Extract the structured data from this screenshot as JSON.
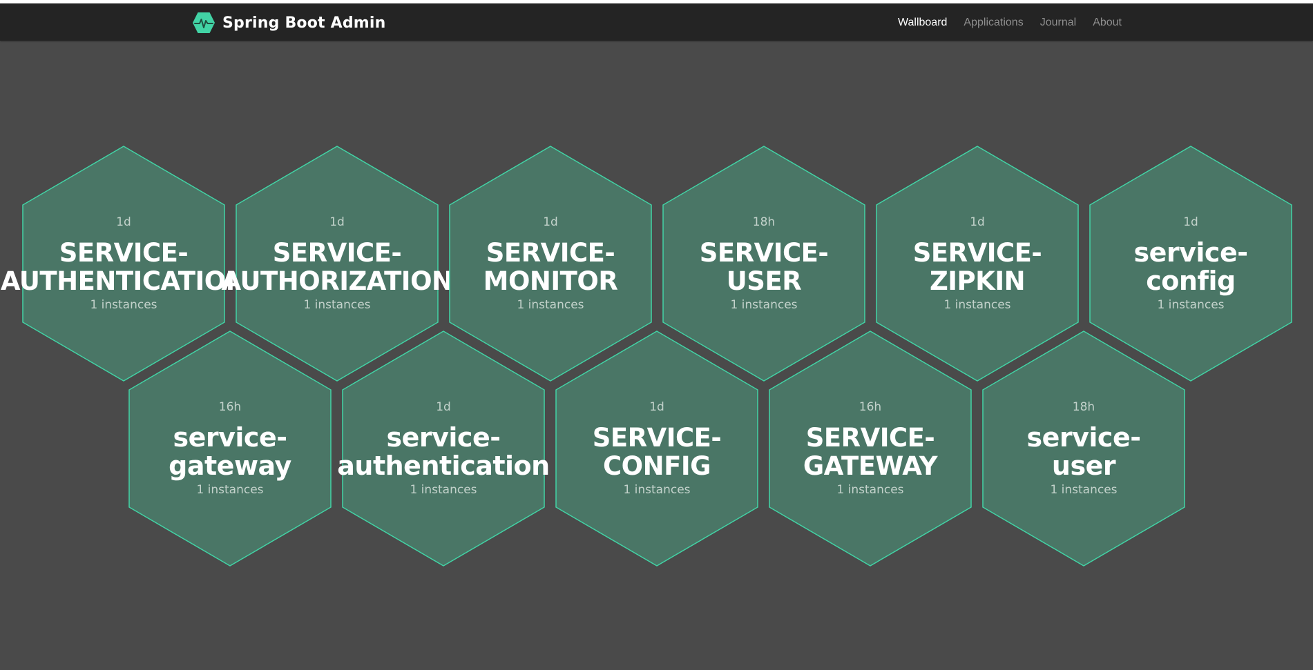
{
  "brand": {
    "title": "Spring Boot Admin",
    "icon": "heartbeat-icon",
    "accent": "#42d3a5"
  },
  "nav": [
    {
      "label": "Wallboard",
      "active": true
    },
    {
      "label": "Applications",
      "active": false
    },
    {
      "label": "Journal",
      "active": false
    },
    {
      "label": "About",
      "active": false
    }
  ],
  "colors": {
    "background": "#4a4a4a",
    "navbar": "#242424",
    "hex_fill": "#4a7666",
    "hex_stroke": "#42d3a5"
  },
  "applications": [
    {
      "uptime": "1d",
      "name_line1": "SERVICE-",
      "name_line2": "AUTHENTICATION",
      "instances": "1 instances"
    },
    {
      "uptime": "1d",
      "name_line1": "SERVICE-",
      "name_line2": "AUTHORIZATION",
      "instances": "1 instances"
    },
    {
      "uptime": "1d",
      "name_line1": "SERVICE-",
      "name_line2": "MONITOR",
      "instances": "1 instances"
    },
    {
      "uptime": "18h",
      "name_line1": "SERVICE-",
      "name_line2": "USER",
      "instances": "1 instances"
    },
    {
      "uptime": "1d",
      "name_line1": "SERVICE-",
      "name_line2": "ZIPKIN",
      "instances": "1 instances"
    },
    {
      "uptime": "1d",
      "name_line1": "service-",
      "name_line2": "config",
      "instances": "1 instances"
    },
    {
      "uptime": "16h",
      "name_line1": "service-",
      "name_line2": "gateway",
      "instances": "1 instances"
    },
    {
      "uptime": "1d",
      "name_line1": "service-",
      "name_line2": "authentication",
      "instances": "1 instances"
    },
    {
      "uptime": "1d",
      "name_line1": "SERVICE-",
      "name_line2": "CONFIG",
      "instances": "1 instances"
    },
    {
      "uptime": "16h",
      "name_line1": "SERVICE-",
      "name_line2": "GATEWAY",
      "instances": "1 instances"
    },
    {
      "uptime": "18h",
      "name_line1": "service-",
      "name_line2": "user",
      "instances": "1 instances"
    }
  ]
}
